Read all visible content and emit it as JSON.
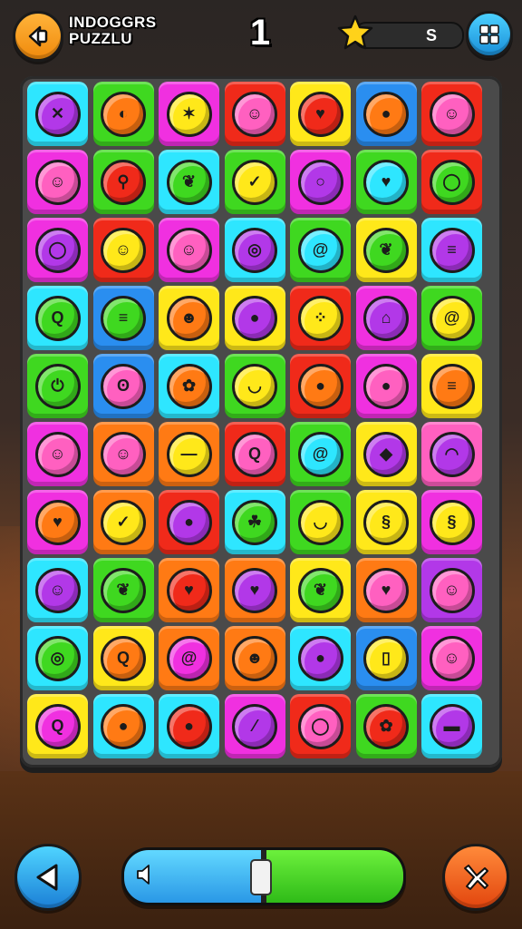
{
  "header": {
    "title_line1": "INDOGGRS",
    "title_line2": "PUZZLU",
    "level": "1",
    "score": "S"
  },
  "progress": {
    "fraction": 0.5
  },
  "colors": {
    "cyan": "#2ee6ff",
    "green": "#3fd820",
    "magenta": "#f030e0",
    "red": "#f02a1a",
    "yellow": "#ffe81a",
    "blue": "#2a8ef0",
    "orange": "#ff7a14",
    "purple": "#b238e8",
    "pink": "#ff60c0"
  },
  "board": {
    "rows": [
      [
        {
          "bg": "cyan",
          "icon": "purple",
          "name": "crossed-candy-icon",
          "glyph": "✕"
        },
        {
          "bg": "green",
          "icon": "orange",
          "name": "orange-pill-icon",
          "glyph": "◐"
        },
        {
          "bg": "magenta",
          "icon": "yellow",
          "name": "pineapple-icon",
          "glyph": "✶"
        },
        {
          "bg": "red",
          "icon": "pink",
          "name": "smiley-egg-icon",
          "glyph": "☺"
        },
        {
          "bg": "yellow",
          "icon": "red",
          "name": "red-heart-icon",
          "glyph": "♥"
        },
        {
          "bg": "blue",
          "icon": "orange",
          "name": "orange-drop-icon",
          "glyph": "●"
        },
        {
          "bg": "red",
          "icon": "pink",
          "name": "pink-pig-icon",
          "glyph": "☺"
        }
      ],
      [
        {
          "bg": "magenta",
          "icon": "pink",
          "name": "pink-face-icon",
          "glyph": "☺"
        },
        {
          "bg": "green",
          "icon": "red",
          "name": "candy-stick-icon",
          "glyph": "⚲"
        },
        {
          "bg": "cyan",
          "icon": "green",
          "name": "leaf-icon",
          "glyph": "❦"
        },
        {
          "bg": "green",
          "icon": "yellow",
          "name": "yellow-check-icon",
          "glyph": "✓"
        },
        {
          "bg": "magenta",
          "icon": "purple",
          "name": "purple-button-icon",
          "glyph": "○"
        },
        {
          "bg": "green",
          "icon": "cyan",
          "name": "cyan-heart-icon",
          "glyph": "♥"
        },
        {
          "bg": "red",
          "icon": "green",
          "name": "green-ring-icon",
          "glyph": "◯"
        }
      ],
      [
        {
          "bg": "magenta",
          "icon": "purple",
          "name": "purple-ring-icon",
          "glyph": "◯"
        },
        {
          "bg": "red",
          "icon": "yellow",
          "name": "yellow-face-icon",
          "glyph": "☺"
        },
        {
          "bg": "magenta",
          "icon": "pink",
          "name": "pink-egg-face-icon",
          "glyph": "☺"
        },
        {
          "bg": "cyan",
          "icon": "purple",
          "name": "purple-ball-icon",
          "glyph": "◎"
        },
        {
          "bg": "green",
          "icon": "cyan",
          "name": "spiral-candy-icon",
          "glyph": "@"
        },
        {
          "bg": "yellow",
          "icon": "green",
          "name": "green-leaf-icon",
          "glyph": "❦"
        },
        {
          "bg": "cyan",
          "icon": "purple",
          "name": "striped-ball-icon",
          "glyph": "≡"
        }
      ],
      [
        {
          "bg": "cyan",
          "icon": "green",
          "name": "magnifier-candy-icon",
          "glyph": "Q"
        },
        {
          "bg": "blue",
          "icon": "green",
          "name": "green-stripe-icon",
          "glyph": "≡"
        },
        {
          "bg": "yellow",
          "icon": "orange",
          "name": "orange-monster-icon",
          "glyph": "☻"
        },
        {
          "bg": "yellow",
          "icon": "purple",
          "name": "purple-orb-icon",
          "glyph": "●"
        },
        {
          "bg": "red",
          "icon": "yellow",
          "name": "yellow-dots-icon",
          "glyph": "⁘"
        },
        {
          "bg": "magenta",
          "icon": "purple",
          "name": "house-candy-icon",
          "glyph": "⌂"
        },
        {
          "bg": "green",
          "icon": "yellow",
          "name": "yellow-swirl-icon",
          "glyph": "@"
        }
      ],
      [
        {
          "bg": "green",
          "icon": "green",
          "name": "green-power-icon",
          "glyph": "⏻"
        },
        {
          "bg": "blue",
          "icon": "pink",
          "name": "pink-tooth-icon",
          "glyph": "ʘ"
        },
        {
          "bg": "cyan",
          "icon": "orange",
          "name": "flower-icon",
          "glyph": "✿"
        },
        {
          "bg": "green",
          "icon": "yellow",
          "name": "yellow-smile-icon",
          "glyph": "◡"
        },
        {
          "bg": "red",
          "icon": "orange",
          "name": "orange-drop-icon-2",
          "glyph": "●"
        },
        {
          "bg": "magenta",
          "icon": "pink",
          "name": "pink-petal-icon",
          "glyph": "●"
        },
        {
          "bg": "yellow",
          "icon": "orange",
          "name": "pancake-stack-icon",
          "glyph": "≡"
        }
      ],
      [
        {
          "bg": "magenta",
          "icon": "pink",
          "name": "pink-bunny-icon",
          "glyph": "☺"
        },
        {
          "bg": "orange",
          "icon": "pink",
          "name": "pink-ghost-icon",
          "glyph": "☺"
        },
        {
          "bg": "orange",
          "icon": "yellow",
          "name": "yellow-disc-icon",
          "glyph": "—"
        },
        {
          "bg": "red",
          "icon": "pink",
          "name": "spiky-ring-icon",
          "glyph": "Q"
        },
        {
          "bg": "green",
          "icon": "cyan",
          "name": "cyan-swirl-icon",
          "glyph": "@"
        },
        {
          "bg": "yellow",
          "icon": "purple",
          "name": "purple-gem-icon",
          "glyph": "◆"
        },
        {
          "bg": "pink",
          "icon": "purple",
          "name": "purple-lips-icon",
          "glyph": "◠"
        }
      ],
      [
        {
          "bg": "magenta",
          "icon": "orange",
          "name": "orange-heart-icon",
          "glyph": "♥"
        },
        {
          "bg": "orange",
          "icon": "yellow",
          "name": "yellow-check-icon-2",
          "glyph": "✓"
        },
        {
          "bg": "red",
          "icon": "purple",
          "name": "purple-orb-icon-2",
          "glyph": "●"
        },
        {
          "bg": "cyan",
          "icon": "green",
          "name": "green-sprout-icon",
          "glyph": "☘"
        },
        {
          "bg": "green",
          "icon": "yellow",
          "name": "yellow-smile-icon-2",
          "glyph": "◡"
        },
        {
          "bg": "yellow",
          "icon": "yellow",
          "name": "yellow-coin-icon",
          "glyph": "§"
        },
        {
          "bg": "magenta",
          "icon": "yellow",
          "name": "yellow-swirl-icon-2",
          "glyph": "§"
        }
      ],
      [
        {
          "bg": "cyan",
          "icon": "purple",
          "name": "purple-drop-face-icon",
          "glyph": "☺"
        },
        {
          "bg": "green",
          "icon": "green",
          "name": "green-leaf-bubble-icon",
          "glyph": "❦"
        },
        {
          "bg": "orange",
          "icon": "red",
          "name": "red-heart-icon-2",
          "glyph": "♥"
        },
        {
          "bg": "orange",
          "icon": "purple",
          "name": "purple-heart-icon",
          "glyph": "♥"
        },
        {
          "bg": "yellow",
          "icon": "green",
          "name": "green-leaf-icon-2",
          "glyph": "❦"
        },
        {
          "bg": "orange",
          "icon": "pink",
          "name": "pink-heart-icon",
          "glyph": "♥"
        },
        {
          "bg": "purple",
          "icon": "pink",
          "name": "pink-face-icon-2",
          "glyph": "☺"
        }
      ],
      [
        {
          "bg": "cyan",
          "icon": "green",
          "name": "target-candy-icon",
          "glyph": "◎"
        },
        {
          "bg": "yellow",
          "icon": "orange",
          "name": "orange-magnifier-icon",
          "glyph": "Q"
        },
        {
          "bg": "orange",
          "icon": "magenta",
          "name": "magenta-swirl-icon",
          "glyph": "@"
        },
        {
          "bg": "orange",
          "icon": "orange",
          "name": "orange-face-icon",
          "glyph": "☻"
        },
        {
          "bg": "cyan",
          "icon": "purple",
          "name": "purple-plum-icon",
          "glyph": "●"
        },
        {
          "bg": "blue",
          "icon": "yellow",
          "name": "yellow-square-icon",
          "glyph": "▯"
        },
        {
          "bg": "magenta",
          "icon": "pink",
          "name": "pink-pig-icon-2",
          "glyph": "☺"
        }
      ],
      [
        {
          "bg": "yellow",
          "icon": "magenta",
          "name": "lollipop-icon",
          "glyph": "Q"
        },
        {
          "bg": "cyan",
          "icon": "orange",
          "name": "lemon-icon",
          "glyph": "●"
        },
        {
          "bg": "cyan",
          "icon": "red",
          "name": "cherry-icon",
          "glyph": "●"
        },
        {
          "bg": "magenta",
          "icon": "purple",
          "name": "broom-candy-icon",
          "glyph": "⁄"
        },
        {
          "bg": "red",
          "icon": "pink",
          "name": "pink-ring-icon-2",
          "glyph": "◯"
        },
        {
          "bg": "green",
          "icon": "red",
          "name": "red-flower-icon",
          "glyph": "✿"
        },
        {
          "bg": "cyan",
          "icon": "purple",
          "name": "purple-mask-icon",
          "glyph": "▬"
        }
      ]
    ]
  }
}
